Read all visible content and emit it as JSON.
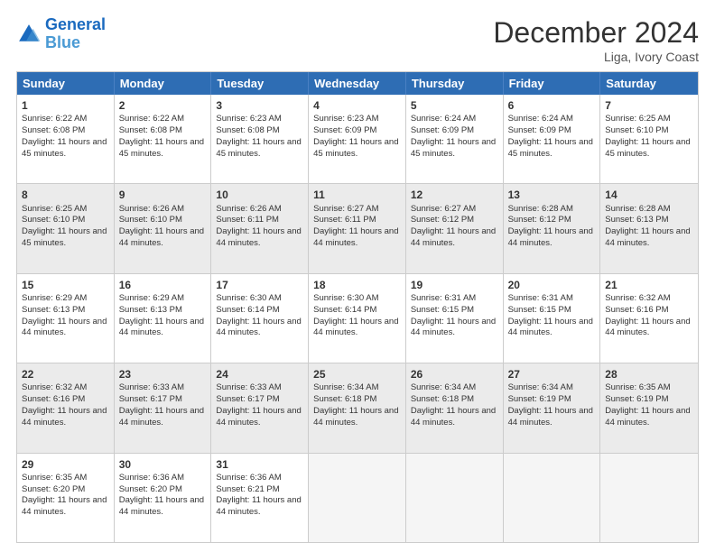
{
  "logo": {
    "line1": "General",
    "line2": "Blue"
  },
  "title": "December 2024",
  "location": "Liga, Ivory Coast",
  "days_of_week": [
    "Sunday",
    "Monday",
    "Tuesday",
    "Wednesday",
    "Thursday",
    "Friday",
    "Saturday"
  ],
  "weeks": [
    [
      {
        "day": 1,
        "sunrise": "6:22 AM",
        "sunset": "6:08 PM",
        "daylight": "11 hours and 45 minutes."
      },
      {
        "day": 2,
        "sunrise": "6:22 AM",
        "sunset": "6:08 PM",
        "daylight": "11 hours and 45 minutes."
      },
      {
        "day": 3,
        "sunrise": "6:23 AM",
        "sunset": "6:08 PM",
        "daylight": "11 hours and 45 minutes."
      },
      {
        "day": 4,
        "sunrise": "6:23 AM",
        "sunset": "6:09 PM",
        "daylight": "11 hours and 45 minutes."
      },
      {
        "day": 5,
        "sunrise": "6:24 AM",
        "sunset": "6:09 PM",
        "daylight": "11 hours and 45 minutes."
      },
      {
        "day": 6,
        "sunrise": "6:24 AM",
        "sunset": "6:09 PM",
        "daylight": "11 hours and 45 minutes."
      },
      {
        "day": 7,
        "sunrise": "6:25 AM",
        "sunset": "6:10 PM",
        "daylight": "11 hours and 45 minutes."
      }
    ],
    [
      {
        "day": 8,
        "sunrise": "6:25 AM",
        "sunset": "6:10 PM",
        "daylight": "11 hours and 45 minutes."
      },
      {
        "day": 9,
        "sunrise": "6:26 AM",
        "sunset": "6:10 PM",
        "daylight": "11 hours and 44 minutes."
      },
      {
        "day": 10,
        "sunrise": "6:26 AM",
        "sunset": "6:11 PM",
        "daylight": "11 hours and 44 minutes."
      },
      {
        "day": 11,
        "sunrise": "6:27 AM",
        "sunset": "6:11 PM",
        "daylight": "11 hours and 44 minutes."
      },
      {
        "day": 12,
        "sunrise": "6:27 AM",
        "sunset": "6:12 PM",
        "daylight": "11 hours and 44 minutes."
      },
      {
        "day": 13,
        "sunrise": "6:28 AM",
        "sunset": "6:12 PM",
        "daylight": "11 hours and 44 minutes."
      },
      {
        "day": 14,
        "sunrise": "6:28 AM",
        "sunset": "6:13 PM",
        "daylight": "11 hours and 44 minutes."
      }
    ],
    [
      {
        "day": 15,
        "sunrise": "6:29 AM",
        "sunset": "6:13 PM",
        "daylight": "11 hours and 44 minutes."
      },
      {
        "day": 16,
        "sunrise": "6:29 AM",
        "sunset": "6:13 PM",
        "daylight": "11 hours and 44 minutes."
      },
      {
        "day": 17,
        "sunrise": "6:30 AM",
        "sunset": "6:14 PM",
        "daylight": "11 hours and 44 minutes."
      },
      {
        "day": 18,
        "sunrise": "6:30 AM",
        "sunset": "6:14 PM",
        "daylight": "11 hours and 44 minutes."
      },
      {
        "day": 19,
        "sunrise": "6:31 AM",
        "sunset": "6:15 PM",
        "daylight": "11 hours and 44 minutes."
      },
      {
        "day": 20,
        "sunrise": "6:31 AM",
        "sunset": "6:15 PM",
        "daylight": "11 hours and 44 minutes."
      },
      {
        "day": 21,
        "sunrise": "6:32 AM",
        "sunset": "6:16 PM",
        "daylight": "11 hours and 44 minutes."
      }
    ],
    [
      {
        "day": 22,
        "sunrise": "6:32 AM",
        "sunset": "6:16 PM",
        "daylight": "11 hours and 44 minutes."
      },
      {
        "day": 23,
        "sunrise": "6:33 AM",
        "sunset": "6:17 PM",
        "daylight": "11 hours and 44 minutes."
      },
      {
        "day": 24,
        "sunrise": "6:33 AM",
        "sunset": "6:17 PM",
        "daylight": "11 hours and 44 minutes."
      },
      {
        "day": 25,
        "sunrise": "6:34 AM",
        "sunset": "6:18 PM",
        "daylight": "11 hours and 44 minutes."
      },
      {
        "day": 26,
        "sunrise": "6:34 AM",
        "sunset": "6:18 PM",
        "daylight": "11 hours and 44 minutes."
      },
      {
        "day": 27,
        "sunrise": "6:34 AM",
        "sunset": "6:19 PM",
        "daylight": "11 hours and 44 minutes."
      },
      {
        "day": 28,
        "sunrise": "6:35 AM",
        "sunset": "6:19 PM",
        "daylight": "11 hours and 44 minutes."
      }
    ],
    [
      {
        "day": 29,
        "sunrise": "6:35 AM",
        "sunset": "6:20 PM",
        "daylight": "11 hours and 44 minutes."
      },
      {
        "day": 30,
        "sunrise": "6:36 AM",
        "sunset": "6:20 PM",
        "daylight": "11 hours and 44 minutes."
      },
      {
        "day": 31,
        "sunrise": "6:36 AM",
        "sunset": "6:21 PM",
        "daylight": "11 hours and 44 minutes."
      },
      null,
      null,
      null,
      null
    ]
  ]
}
